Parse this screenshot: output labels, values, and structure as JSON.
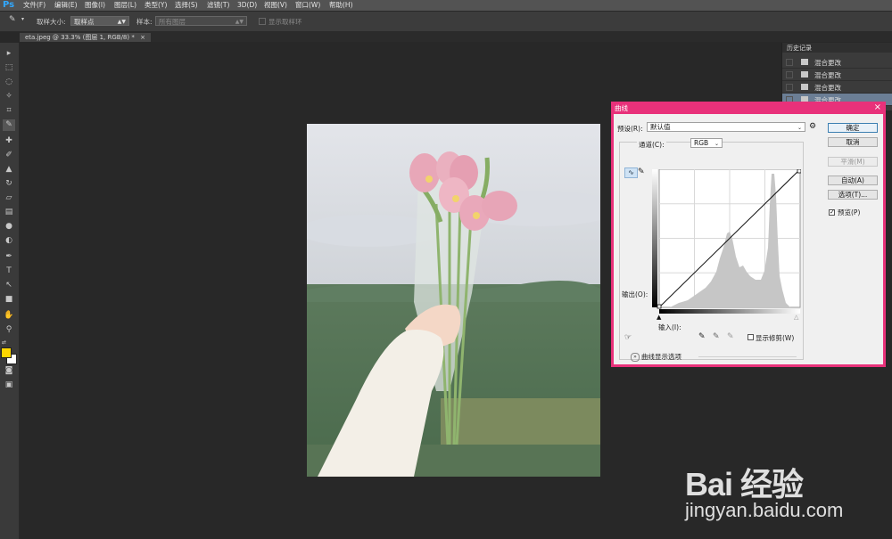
{
  "app": {
    "logo": "Ps"
  },
  "menu": [
    "文件(F)",
    "编辑(E)",
    "图像(I)",
    "图层(L)",
    "类型(Y)",
    "选择(S)",
    "滤镜(T)",
    "3D(D)",
    "视图(V)",
    "窗口(W)",
    "帮助(H)"
  ],
  "options": {
    "sample_size_label": "取样大小:",
    "sample_size_value": "取样点",
    "sample_label": "样本:",
    "sample_value": "所有图层",
    "show_ring_label": "显示取样环"
  },
  "document": {
    "tab_title": "eta.jpeg @ 33.3% (图层 1, RGB/8) *",
    "tab_close": "×"
  },
  "history": {
    "title": "历史记录",
    "items": [
      "混合更改",
      "混合更改",
      "混合更改",
      "混合更改"
    ]
  },
  "curves": {
    "title": "曲线",
    "close": "×",
    "preset_label": "预设(R):",
    "preset_value": "默认值",
    "channel_label": "通道(C):",
    "channel_value": "RGB",
    "output_label": "输出(O):",
    "input_label": "输入(I):",
    "show_clipping_label": "显示修剪(W)",
    "display_options_label": "曲线显示选项",
    "buttons": {
      "ok": "确定",
      "cancel": "取消",
      "smooth": "平滑(M)",
      "auto": "自动(A)",
      "options": "选项(T)..."
    },
    "preview_label": "预览(P)",
    "preview_checked": true
  },
  "watermark": {
    "brand": "Bai 经验",
    "site": "jingyan.baidu.com"
  },
  "colors": {
    "foreground": "#ffd700",
    "background": "#ffffff",
    "dialog_accent": "#e8317a"
  }
}
